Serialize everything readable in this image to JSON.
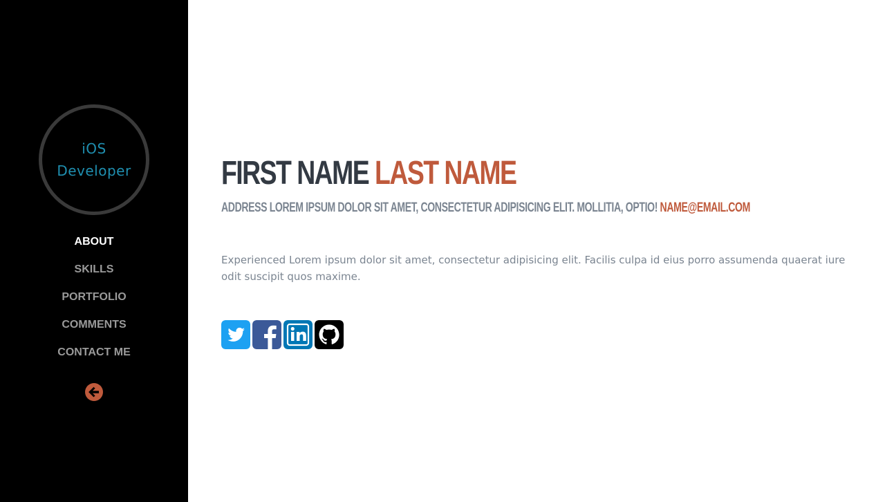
{
  "sidebar": {
    "avatar": {
      "line1": "iOS",
      "line2": "Developer"
    },
    "nav": [
      "ABOUT",
      "SKILLS",
      "PORTFOLIO",
      "COMMENTS",
      "CONTACT ME"
    ],
    "active_item": "ABOUT",
    "back_icon": "arrow-circle-left-icon"
  },
  "main": {
    "first_name": "FIRST NAME",
    "last_name": "LAST NAME",
    "address": "ADDRESS LOREM IPSUM DOLOR SIT AMET, CONSECTETUR ADIPISICING ELIT. MOLLITIA, OPTIO!",
    "email": "NAME@EMAIL.COM",
    "bio": "Experienced Lorem ipsum dolor sit amet, consectetur adipisicing elit. Facilis culpa id eius porro assumenda quaerat iure odit suscipit quos maxime.",
    "social": [
      "twitter-icon",
      "facebook-icon",
      "linkedin-icon",
      "github-icon"
    ]
  },
  "colors": {
    "sidebar_bg": "#000000",
    "accent": "#bf5a3c",
    "name_dark": "#333a43",
    "muted_text": "#7b8591",
    "avatar_text": "#1f8fb0",
    "twitter": "#1da1f2",
    "facebook": "#3b5998",
    "linkedin": "#0077b5",
    "github": "#000000"
  }
}
